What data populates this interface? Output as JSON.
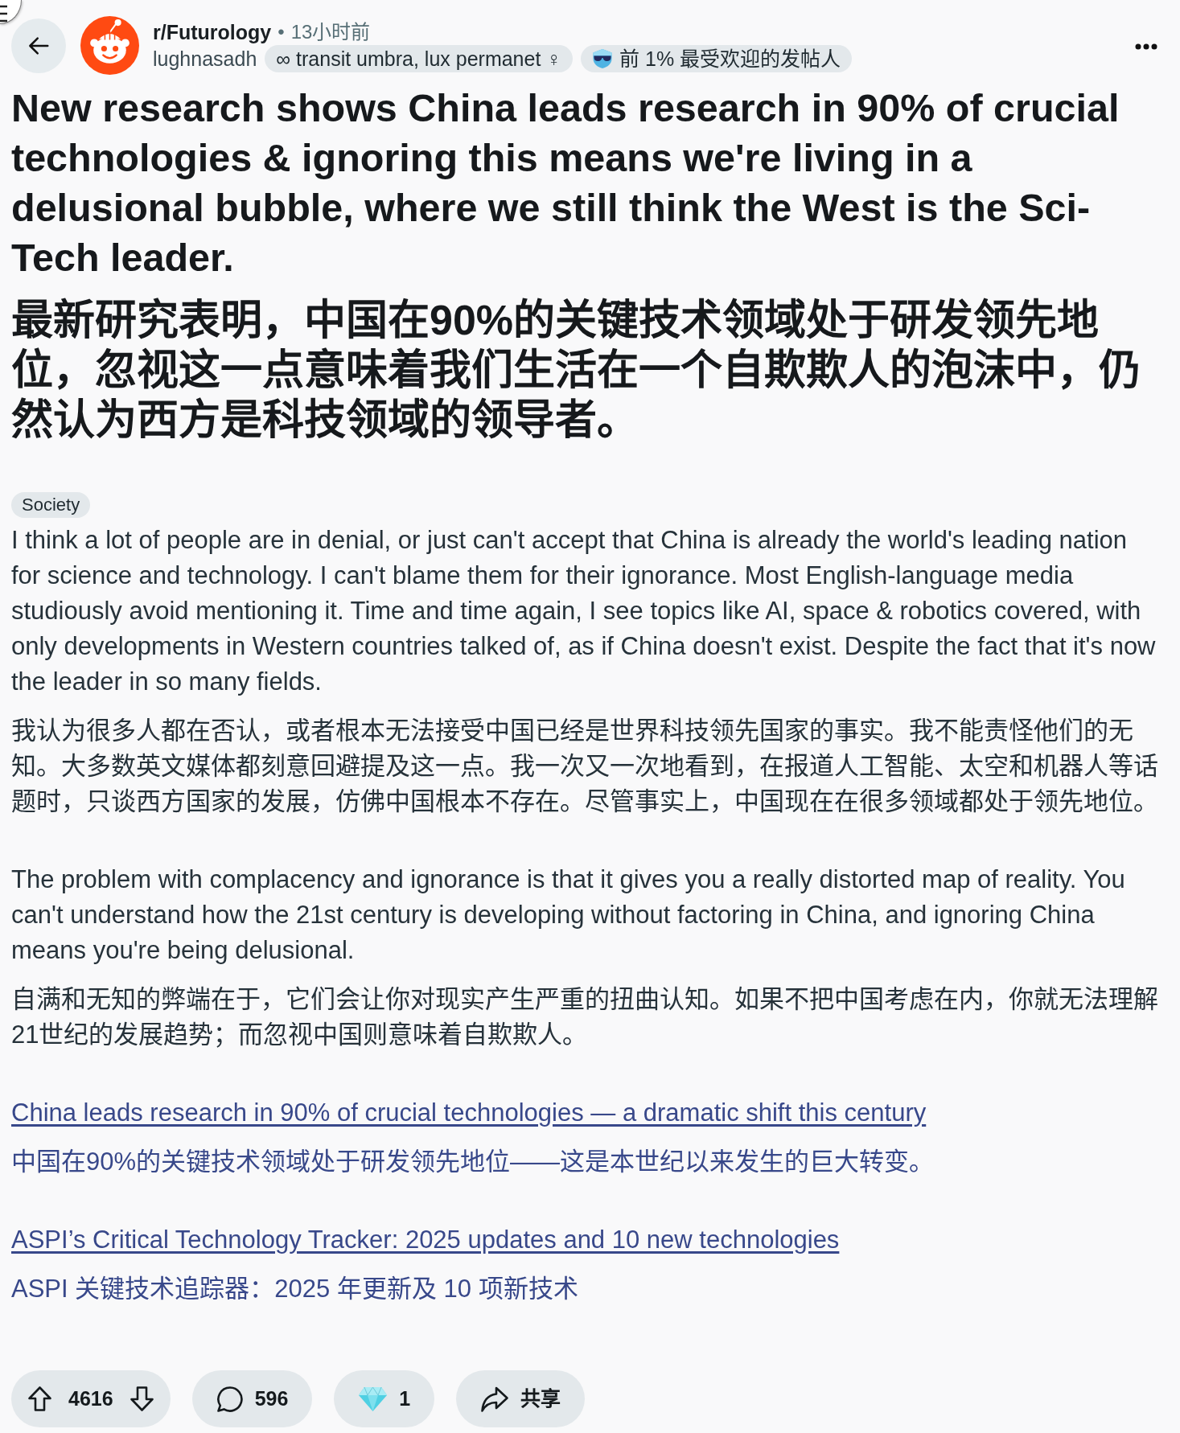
{
  "post": {
    "subreddit": "r/Futurology",
    "separator": "•",
    "time": "13小时前",
    "author": "lughnasadh",
    "flairs": [
      {
        "kind": "user_flair",
        "text": "∞ transit umbra, lux permanet ♀"
      },
      {
        "kind": "achievement",
        "text": "前 1% 最受欢迎的发帖人"
      }
    ],
    "title": {
      "text": "New research shows China leads research in 90% of crucial technologies & ignoring this means we're living in a delusional bubble, where we still think the West is the Sci-Tech leader.",
      "translation": "最新研究表明，中国在90%的关键技术领域处于研发领先地位，忽视这一点意味着我们生活在一个自欺欺人的泡沫中，仍然认为西方是科技领域的领导者。"
    },
    "tag": "Society",
    "paragraphs": [
      {
        "text": "I think a lot of people are in denial, or just can't accept that China is already the world's leading nation for science and technology. I can't blame them for their ignorance. Most English-language media studiously avoid mentioning it. Time and time again, I see topics like AI, space & robotics covered, with only developments in Western countries talked of, as if China doesn't exist. Despite the fact that it's now the leader in so many fields.",
        "translation": "我认为很多人都在否认，或者根本无法接受中国已经是世界科技领先国家的事实。我不能责怪他们的无知。大多数英文媒体都刻意回避提及这一点。我一次又一次地看到，在报道人工智能、太空和机器人等话题时，只谈西方国家的发展，仿佛中国根本不存在。尽管事实上，中国现在在很多领域都处于领先地位。"
      },
      {
        "text": "The problem with complacency and ignorance is that it gives you a really distorted map of reality. You can't understand how the 21st century is developing without factoring in China, and ignoring China means you're being delusional.",
        "translation": "自满和无知的弊端在于，它们会让你对现实产生严重的扭曲认知。如果不把中国考虑在内，你就无法理解21世纪的发展趋势；而忽视中国则意味着自欺欺人。"
      }
    ],
    "links": [
      {
        "text": "China leads research in 90% of crucial technologies — a dramatic shift this century",
        "translation": "中国在90%的关键技术领域处于研发领先地位——这是本世纪以来发生的巨大转变。"
      },
      {
        "text": "ASPI’s Critical Technology Tracker: 2025 updates and 10 new technologies",
        "translation": "ASPI 关键技术追踪器：2025 年更新及 10 项新技术"
      }
    ],
    "actions": [
      {
        "kind": "vote",
        "label": "4616"
      },
      {
        "kind": "comments",
        "label": "596"
      },
      {
        "kind": "award",
        "label": "1"
      },
      {
        "kind": "share",
        "label": "共享"
      }
    ]
  }
}
